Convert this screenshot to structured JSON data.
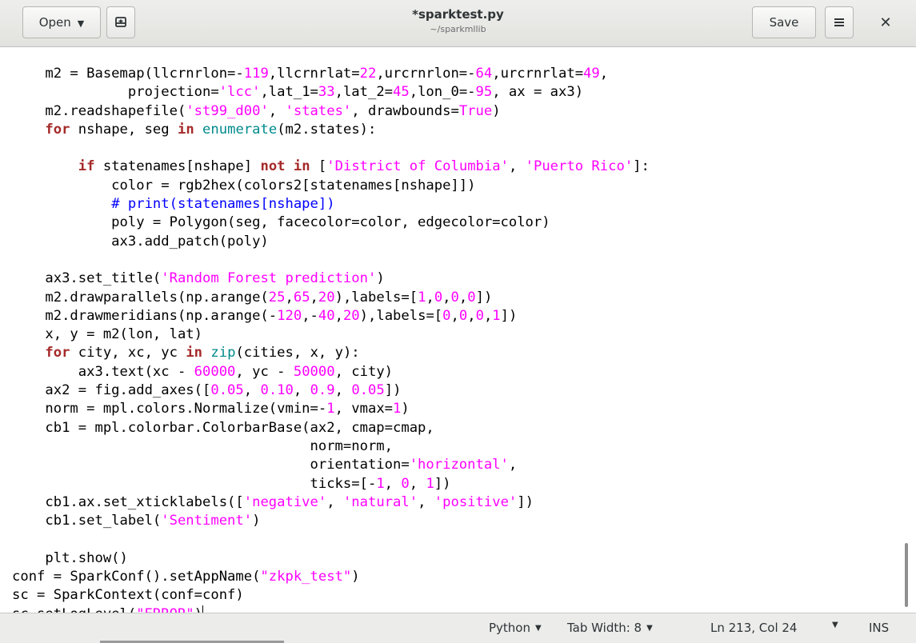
{
  "header": {
    "open_label": "Open",
    "save_label": "Save",
    "title": "*sparktest.py",
    "subtitle": "~/sparkmllib"
  },
  "icons": {
    "chevron": "chevron-down-icon",
    "pin": "new-tab-icon",
    "menu": "hamburger-menu-icon",
    "close": "close-icon"
  },
  "code_lines": [
    [
      [
        "    m2 = Basemap(llcrnrlon=-",
        ""
      ],
      [
        "119",
        "num"
      ],
      [
        ",llcrnrlat=",
        ""
      ],
      [
        "22",
        "num"
      ],
      [
        ",urcrnrlon=-",
        ""
      ],
      [
        "64",
        "num"
      ],
      [
        ",urcrnrlat=",
        ""
      ],
      [
        "49",
        "num"
      ],
      [
        ",",
        ""
      ]
    ],
    [
      [
        "              projection=",
        ""
      ],
      [
        "'lcc'",
        "str"
      ],
      [
        ",lat_1=",
        ""
      ],
      [
        "33",
        "num"
      ],
      [
        ",lat_2=",
        ""
      ],
      [
        "45",
        "num"
      ],
      [
        ",lon_0=-",
        ""
      ],
      [
        "95",
        "num"
      ],
      [
        ", ax = ax3)",
        ""
      ]
    ],
    [
      [
        "    m2.readshapefile(",
        ""
      ],
      [
        "'st99_d00'",
        "str"
      ],
      [
        ", ",
        ""
      ],
      [
        "'states'",
        "str"
      ],
      [
        ", drawbounds=",
        ""
      ],
      [
        "True",
        "str"
      ],
      [
        ")",
        ""
      ]
    ],
    [
      [
        "    ",
        ""
      ],
      [
        "for",
        "kw"
      ],
      [
        " nshape, seg ",
        ""
      ],
      [
        "in",
        "kw"
      ],
      [
        " ",
        ""
      ],
      [
        "enumerate",
        "bi"
      ],
      [
        "(m2.states):",
        ""
      ]
    ],
    [],
    [
      [
        "        ",
        ""
      ],
      [
        "if",
        "kw"
      ],
      [
        " statenames[nshape] ",
        ""
      ],
      [
        "not",
        "kw"
      ],
      [
        " ",
        ""
      ],
      [
        "in",
        "kw"
      ],
      [
        " [",
        ""
      ],
      [
        "'District of Columbia'",
        "str"
      ],
      [
        ", ",
        ""
      ],
      [
        "'Puerto Rico'",
        "str"
      ],
      [
        "]:",
        ""
      ]
    ],
    [
      [
        "            color = rgb2hex(colors2[statenames[nshape]])",
        ""
      ]
    ],
    [
      [
        "            ",
        ""
      ],
      [
        "# print(statenames[nshape])",
        "cm"
      ]
    ],
    [
      [
        "            poly = Polygon(seg, facecolor=color, edgecolor=color)",
        ""
      ]
    ],
    [
      [
        "            ax3.add_patch(poly)",
        ""
      ]
    ],
    [],
    [
      [
        "    ax3.set_title(",
        ""
      ],
      [
        "'Random Forest prediction'",
        "str"
      ],
      [
        ")",
        ""
      ]
    ],
    [
      [
        "    m2.drawparallels(np.arange(",
        ""
      ],
      [
        "25",
        "num"
      ],
      [
        ",",
        ""
      ],
      [
        "65",
        "num"
      ],
      [
        ",",
        ""
      ],
      [
        "20",
        "num"
      ],
      [
        "),labels=[",
        ""
      ],
      [
        "1",
        "num"
      ],
      [
        ",",
        ""
      ],
      [
        "0",
        "num"
      ],
      [
        ",",
        ""
      ],
      [
        "0",
        "num"
      ],
      [
        ",",
        ""
      ],
      [
        "0",
        "num"
      ],
      [
        "])",
        ""
      ]
    ],
    [
      [
        "    m2.drawmeridians(np.arange(-",
        ""
      ],
      [
        "120",
        "num"
      ],
      [
        ",-",
        ""
      ],
      [
        "40",
        "num"
      ],
      [
        ",",
        ""
      ],
      [
        "20",
        "num"
      ],
      [
        "),labels=[",
        ""
      ],
      [
        "0",
        "num"
      ],
      [
        ",",
        ""
      ],
      [
        "0",
        "num"
      ],
      [
        ",",
        ""
      ],
      [
        "0",
        "num"
      ],
      [
        ",",
        ""
      ],
      [
        "1",
        "num"
      ],
      [
        "])",
        ""
      ]
    ],
    [
      [
        "    x, y = m2(lon, lat)",
        ""
      ]
    ],
    [
      [
        "    ",
        ""
      ],
      [
        "for",
        "kw"
      ],
      [
        " city, xc, yc ",
        ""
      ],
      [
        "in",
        "kw"
      ],
      [
        " ",
        ""
      ],
      [
        "zip",
        "bi"
      ],
      [
        "(cities, x, y):",
        ""
      ]
    ],
    [
      [
        "        ax3.text(xc - ",
        ""
      ],
      [
        "60000",
        "num"
      ],
      [
        ", yc - ",
        ""
      ],
      [
        "50000",
        "num"
      ],
      [
        ", city)",
        ""
      ]
    ],
    [
      [
        "    ax2 = fig.add_axes([",
        ""
      ],
      [
        "0.05",
        "num"
      ],
      [
        ", ",
        ""
      ],
      [
        "0.10",
        "num"
      ],
      [
        ", ",
        ""
      ],
      [
        "0.9",
        "num"
      ],
      [
        ", ",
        ""
      ],
      [
        "0.05",
        "num"
      ],
      [
        "])",
        ""
      ]
    ],
    [
      [
        "    norm = mpl.colors.Normalize(vmin=-",
        ""
      ],
      [
        "1",
        "num"
      ],
      [
        ", vmax=",
        ""
      ],
      [
        "1",
        "num"
      ],
      [
        ")",
        ""
      ]
    ],
    [
      [
        "    cb1 = mpl.colorbar.ColorbarBase(ax2, cmap=cmap,",
        ""
      ]
    ],
    [
      [
        "                                    norm=norm,",
        ""
      ]
    ],
    [
      [
        "                                    orientation=",
        ""
      ],
      [
        "'horizontal'",
        "str"
      ],
      [
        ",",
        ""
      ]
    ],
    [
      [
        "                                    ticks=[-",
        ""
      ],
      [
        "1",
        "num"
      ],
      [
        ", ",
        ""
      ],
      [
        "0",
        "num"
      ],
      [
        ", ",
        ""
      ],
      [
        "1",
        "num"
      ],
      [
        "])",
        ""
      ]
    ],
    [
      [
        "    cb1.ax.set_xticklabels([",
        ""
      ],
      [
        "'negative'",
        "str"
      ],
      [
        ", ",
        ""
      ],
      [
        "'natural'",
        "str"
      ],
      [
        ", ",
        ""
      ],
      [
        "'positive'",
        "str"
      ],
      [
        "])",
        ""
      ]
    ],
    [
      [
        "    cb1.set_label(",
        ""
      ],
      [
        "'Sentiment'",
        "str"
      ],
      [
        ")",
        ""
      ]
    ],
    [],
    [
      [
        "    plt.show()",
        ""
      ]
    ],
    [
      [
        "conf = SparkConf().setAppName(",
        ""
      ],
      [
        "\"zkpk_test\"",
        "str"
      ],
      [
        ")",
        ""
      ]
    ],
    [
      [
        "sc = SparkContext(conf=conf)",
        ""
      ]
    ],
    [
      [
        "sc.setLogLevel(",
        ""
      ],
      [
        "\"ERROR\"",
        "str"
      ],
      [
        ")",
        ""
      ]
    ]
  ],
  "statusbar": {
    "language": "Python",
    "tab_width": "Tab Width: 8",
    "position": "Ln 213, Col 24",
    "mode": "INS"
  }
}
